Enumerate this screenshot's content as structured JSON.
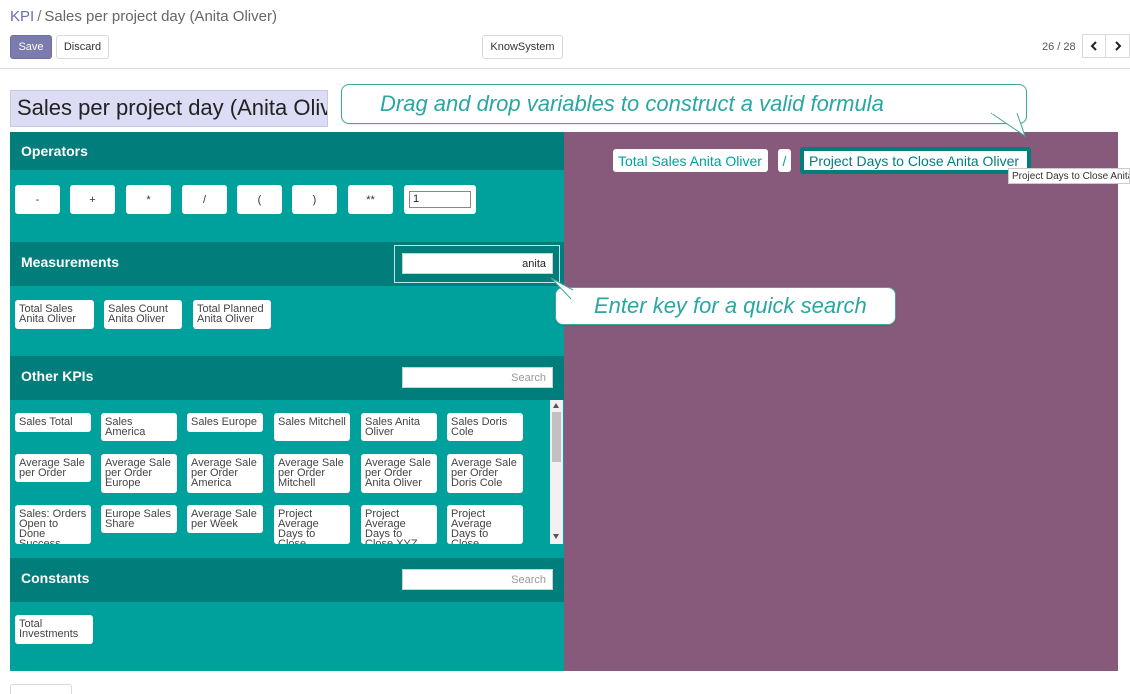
{
  "breadcrumb": {
    "root": "KPI",
    "separator": "/",
    "current": "Sales per project day (Anita Oliver)"
  },
  "toolbar": {
    "save_label": "Save",
    "discard_label": "Discard",
    "knowsystem_label": "KnowSystem"
  },
  "pager": {
    "text": "26 / 28"
  },
  "title_value": "Sales per project day (Anita Oliver)",
  "callouts": {
    "drag": "Drag and drop variables to construct a valid formula",
    "search": "Enter key for a quick search"
  },
  "operators": {
    "heading": "Operators",
    "buttons": [
      "-",
      "+",
      "*",
      "/",
      "(",
      ")",
      "**"
    ],
    "number_value": "1"
  },
  "measurements": {
    "heading": "Measurements",
    "search_value": "anita",
    "items": [
      "Total Sales Anita Oliver",
      "Sales Count Anita Oliver",
      "Total Planned Anita Oliver"
    ]
  },
  "other_kpis": {
    "heading": "Other KPIs",
    "search_placeholder": "Search",
    "items": [
      "Sales Total",
      "Sales America",
      "Sales Europe",
      "Sales Mitchell",
      "Sales Anita Oliver",
      "Sales Doris Cole",
      "Average Sale per Order",
      "Average Sale per Order Europe",
      "Average Sale per Order America",
      "Average Sale per Order Mitchell",
      "Average Sale per Order Anita Oliver",
      "Average Sale per Order Doris Cole",
      "Sales: Orders Open to Done Success",
      "Europe Sales Share",
      "Average Sale per Week",
      "Project Average Days to Close",
      "Project Average Days to Close XYZ Improvements",
      "Project Average Days to Close"
    ]
  },
  "constants": {
    "heading": "Constants",
    "search_placeholder": "Search",
    "items": [
      "Total Investments"
    ]
  },
  "formula": {
    "items": [
      "Total Sales Anita Oliver",
      "/",
      "Project Days to Close Anita Oliver"
    ],
    "tooltip": "Project Days to Close Anita Oliver"
  },
  "colors": {
    "teal": "#00a09d",
    "dark_teal": "#017e7c",
    "purple": "#875a7b",
    "primary": "#7c7bad"
  }
}
